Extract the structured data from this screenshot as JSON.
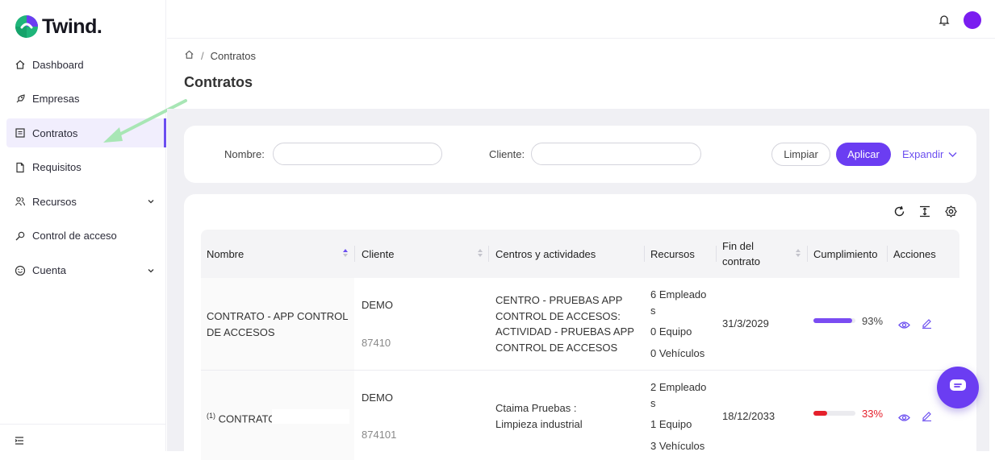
{
  "app": {
    "logo_text": "Twind."
  },
  "sidebar": {
    "items": [
      {
        "label": "Dashboard",
        "icon": "home-icon"
      },
      {
        "label": "Empresas",
        "icon": "rocket-icon"
      },
      {
        "label": "Contratos",
        "icon": "contract-icon",
        "active": true
      },
      {
        "label": "Requisitos",
        "icon": "file-icon"
      },
      {
        "label": "Recursos",
        "icon": "users-icon",
        "expandable": true
      },
      {
        "label": "Control de acceso",
        "icon": "key-icon"
      },
      {
        "label": "Cuenta",
        "icon": "smile-icon",
        "expandable": true
      }
    ]
  },
  "breadcrumb": {
    "current": "Contratos",
    "separator": "/"
  },
  "page": {
    "title": "Contratos"
  },
  "filters": {
    "nombre_label": "Nombre",
    "cliente_label": "Cliente",
    "colon": ":",
    "nombre_value": "",
    "cliente_value": "",
    "clear_label": "Limpiar",
    "apply_label": "Aplicar",
    "expand_label": "Expandir"
  },
  "table": {
    "headers": {
      "nombre": "Nombre",
      "cliente": "Cliente",
      "centros": "Centros y actividades",
      "recursos": "Recursos",
      "fin_line1": "Fin del",
      "fin_line2": "contrato",
      "cumplimiento": "Cumplimiento",
      "acciones": "Acciones"
    },
    "rows": [
      {
        "nombre_line1": "CONTRATO - APP CONTROL",
        "nombre_line2": "DE ACCESOS",
        "cliente": "DEMO",
        "cliente_id": "87410",
        "centros": [
          "CENTRO - PRUEBAS APP",
          "CONTROL DE ACCESOS:",
          "ACTIVIDAD - PRUEBAS APP",
          "CONTROL DE ACCESOS"
        ],
        "recursos": [
          "6 Empleado",
          "s",
          "0 Equipo",
          "0 Vehículos"
        ],
        "fin": "31/3/2029",
        "cumplimiento_pct": 93,
        "cumplimiento_label": "93%",
        "color": "#7a4cf2"
      },
      {
        "nombre_prefix": "(1)",
        "nombre_line1": "CONTRATO",
        "cliente": "DEMO",
        "cliente_id": "874101",
        "centros": [
          "Ctaima Pruebas :",
          "Limpieza industrial"
        ],
        "recursos": [
          "2 Empleado",
          "s",
          "1 Equipo",
          "3 Vehículos"
        ],
        "fin": "18/12/2033",
        "cumplimiento_pct": 33,
        "cumplimiento_label": "33%",
        "color": "#e5202b"
      }
    ]
  },
  "colors": {
    "accent": "#6b3df2",
    "active_bg": "#f1eefd",
    "danger": "#e5202b",
    "avatar": "#7a1df0"
  }
}
